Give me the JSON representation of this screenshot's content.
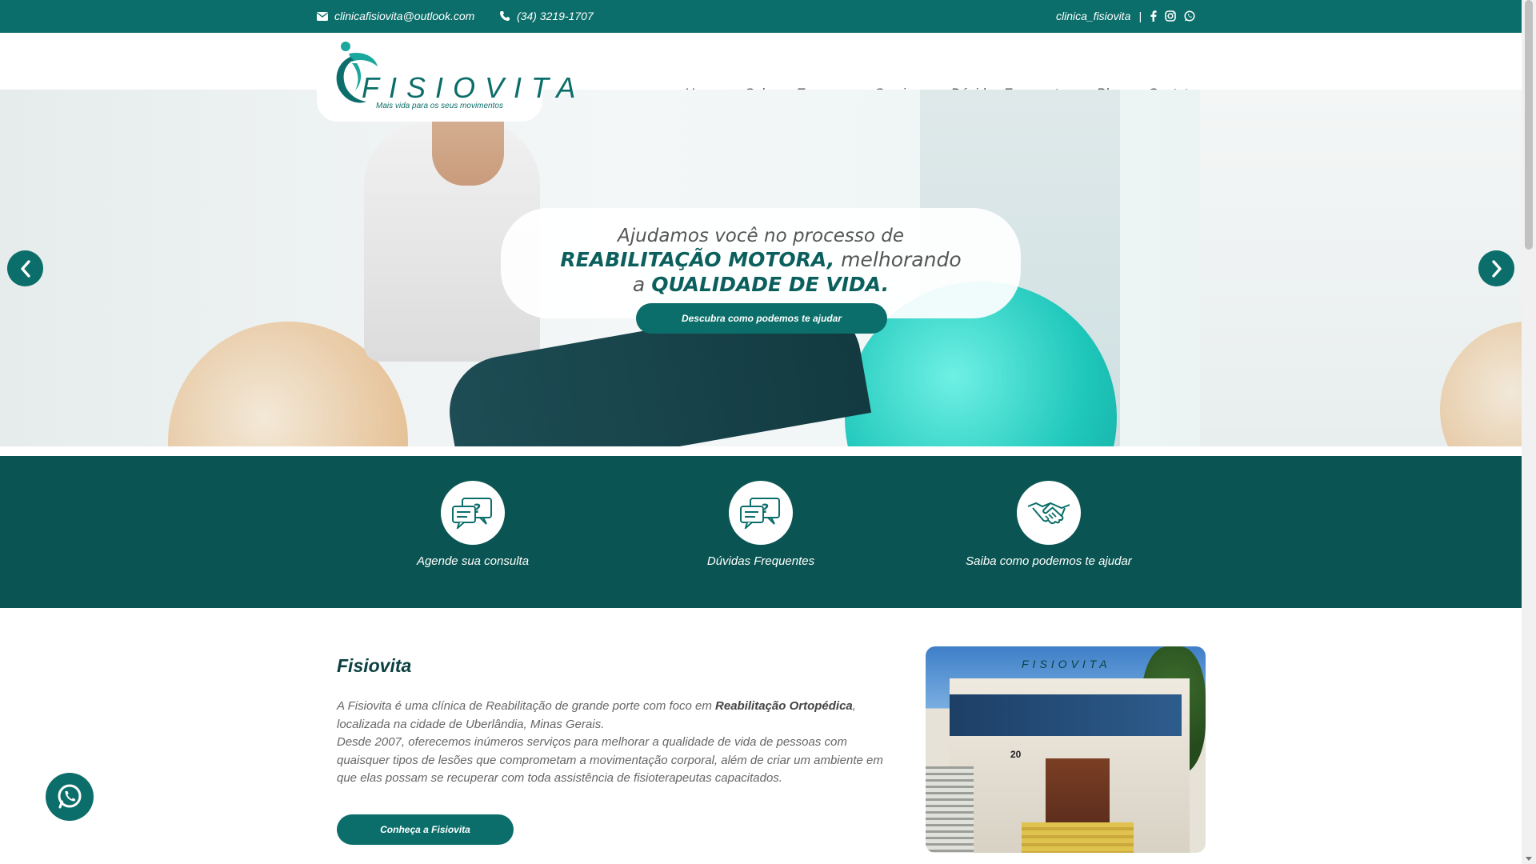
{
  "topbar": {
    "email": "clinicafisiovita@outlook.com",
    "phone": "(34) 3219-1707",
    "handle": "clinica_fisiovita",
    "separator": "|",
    "icons": [
      "mail-icon",
      "phone-icon",
      "facebook-icon",
      "instagram-icon",
      "whatsapp-icon"
    ]
  },
  "brand": {
    "name": "FISIOVITA",
    "tagline": "Mais vida para os seus movimentos"
  },
  "nav": [
    "Home",
    "Sobre a Empresa",
    "Serviços",
    "Dúvidas Frequentes",
    "Blog",
    "Contato"
  ],
  "hero": {
    "line1": "Ajudamos você no processo de",
    "line2_bold": "REABILITAÇÃO MOTORA,",
    "line2_rest": " melhorando",
    "line3_pre": "a ",
    "line3_bold": "QUALIDADE DE VIDA.",
    "cta": "Descubra como podemos te ajudar",
    "prev_icon": "chevron-left-icon",
    "next_icon": "chevron-right-icon"
  },
  "features": [
    {
      "label": "Agende sua consulta",
      "icon": "chat-question-icon"
    },
    {
      "label": "Dúvidas Frequentes",
      "icon": "chat-question-icon"
    },
    {
      "label": "Saiba como podemos te ajudar",
      "icon": "handshake-icon"
    }
  ],
  "about": {
    "title": "Fisiovita",
    "p1_pre": "A Fisiovita é uma clínica de Reabilitação de grande porte com foco em ",
    "p1_bold": "Reabilitação Ortopédica",
    "p1_post": ",",
    "p2": "localizada  na cidade de Uberlândia, Minas Gerais.",
    "p3": "Desde 2007, oferecemos inúmeros serviços para melhorar a qualidade de vida de pessoas com quaisquer tipos de lesões que comprometam a movimentação corporal, além de criar um ambiente em que elas possam se recuperar com toda assistência de fisioterapeutas capacitados.",
    "cta": "Conheça a Fisiovita",
    "photo_sign": "FISIOVITA",
    "photo_number": "20"
  },
  "colors": {
    "primary": "#0b6e6a",
    "dark_band": "#0a5553",
    "title": "#0b3f40"
  }
}
